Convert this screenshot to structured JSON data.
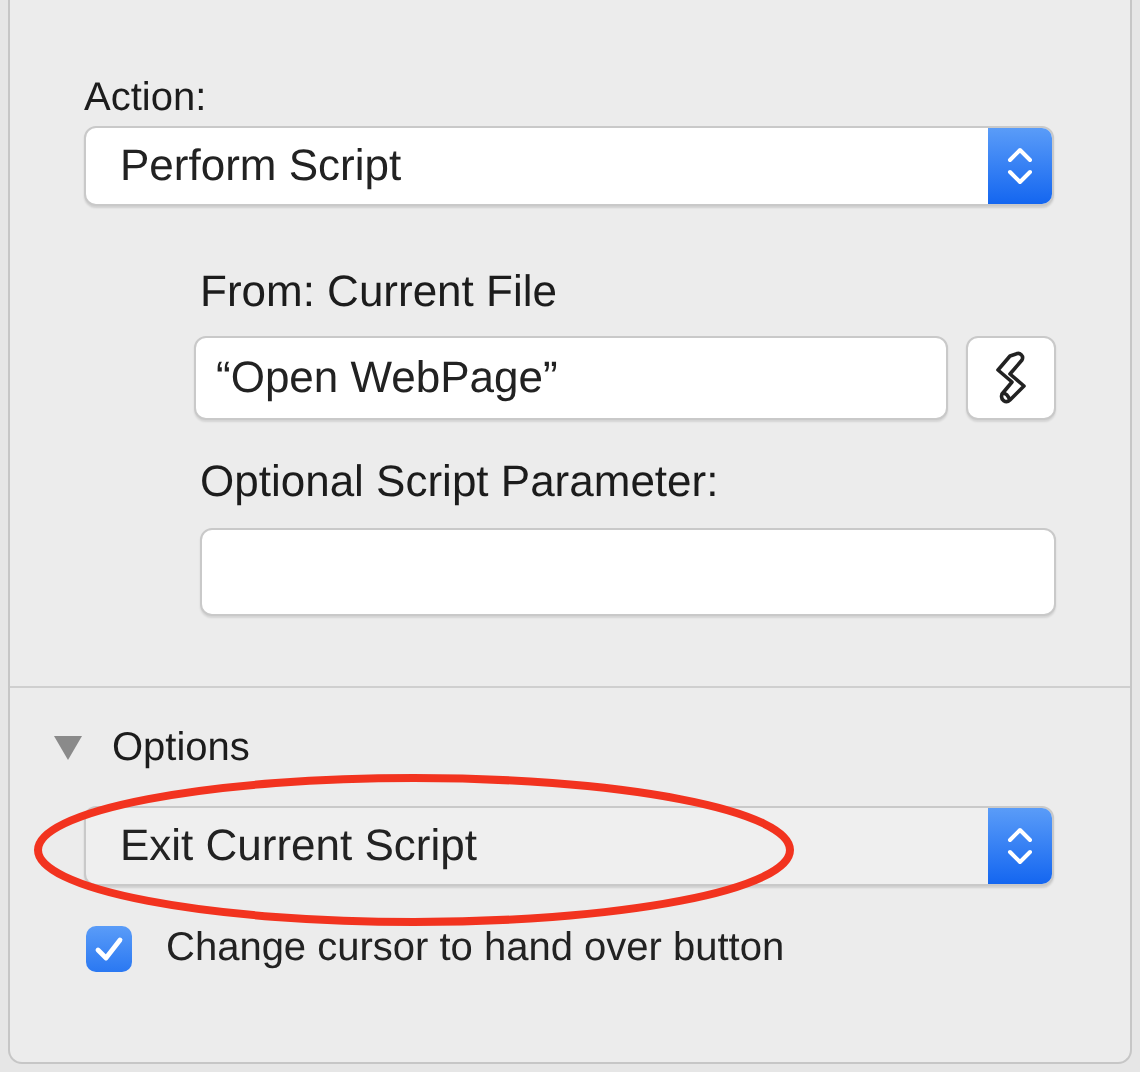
{
  "action": {
    "label": "Action:",
    "popup": {
      "value": "Perform Script"
    }
  },
  "script": {
    "from_label": "From: Current File",
    "script_field": {
      "value": "“Open WebPage”"
    },
    "parameter_label": "Optional Script Parameter:"
  },
  "options": {
    "label": "Options",
    "expanded": true,
    "popup": {
      "value": "Exit Current Script"
    },
    "checkbox": {
      "label": "Change cursor to hand over button",
      "checked": true
    }
  },
  "annotation": {
    "kind": "ellipse"
  }
}
